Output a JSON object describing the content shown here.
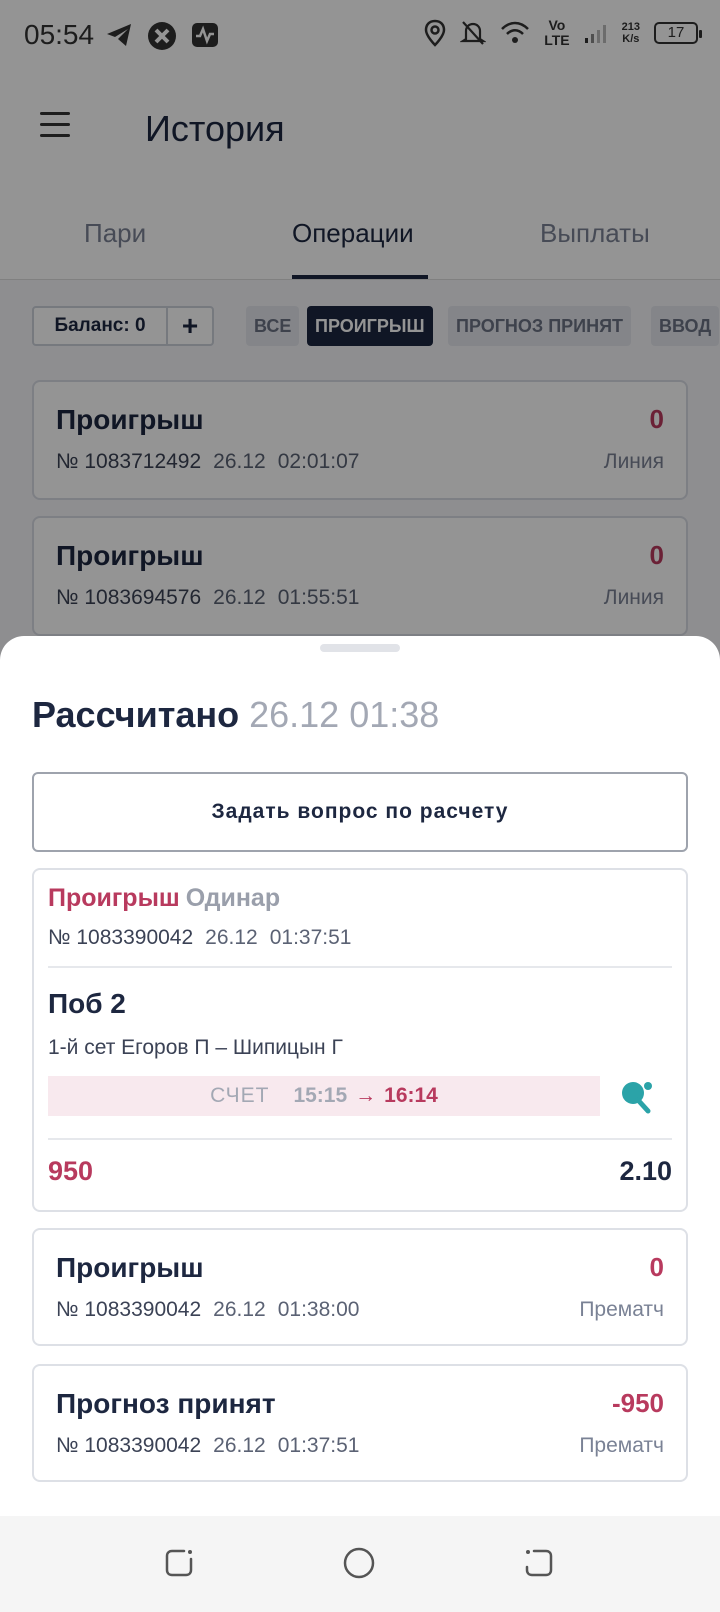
{
  "status_bar": {
    "time": "05:54",
    "network_speed_top": "213",
    "network_speed_bottom": "K/s",
    "volte_top": "Vo",
    "volte_bottom": "LTE",
    "battery": "17",
    "icons": [
      "telegram-icon",
      "app-icon",
      "activity-icon",
      "location-icon",
      "bell-off-icon",
      "wifi-icon",
      "signal-icon",
      "battery-icon"
    ]
  },
  "header": {
    "title": "История",
    "menu_icon": "hamburger-menu-icon"
  },
  "tabs": [
    {
      "label": "Пари",
      "active": false
    },
    {
      "label": "Операции",
      "active": true
    },
    {
      "label": "Выплаты",
      "active": false
    }
  ],
  "filters": {
    "balance_label": "Баланс: 0",
    "add_label": "+",
    "chips": [
      {
        "label": "ВСЕ",
        "active": false
      },
      {
        "label": "ПРОИГРЫШ",
        "active": true
      },
      {
        "label": "ПРОГНОЗ ПРИНЯТ",
        "active": false
      },
      {
        "label": "ВВОД",
        "active": false
      }
    ]
  },
  "background_operations": [
    {
      "title": "Проигрыш",
      "amount": "0",
      "number": "№ 1083712492",
      "date": "26.12",
      "time": "02:01:07",
      "type": "Линия"
    },
    {
      "title": "Проигрыш",
      "amount": "0",
      "number": "№ 1083694576",
      "date": "26.12",
      "time": "01:55:51",
      "type": "Линия"
    }
  ],
  "sheet": {
    "title": "Рассчитано",
    "datetime": "26.12 01:38",
    "ask_button": "Задать вопрос по расчету",
    "bet": {
      "status": "Проигрыш",
      "kind": "Одинар",
      "number": "№ 1083390042",
      "date": "26.12",
      "time": "01:37:51",
      "outcome": "Поб 2",
      "event": "1-й сет Егоров П – Шипицын Г",
      "score_label": "СЧЕТ",
      "score_from": "15:15",
      "score_arrow": "→",
      "score_to": "16:14",
      "sport_icon": "table-tennis-icon",
      "stake": "950",
      "coefficient": "2.10"
    },
    "operations": [
      {
        "title": "Проигрыш",
        "amount": "0",
        "number": "№ 1083390042",
        "date": "26.12",
        "time": "01:38:00",
        "type": "Прематч"
      },
      {
        "title": "Прогноз принят",
        "amount": "-950",
        "number": "№ 1083390042",
        "date": "26.12",
        "time": "01:37:51",
        "type": "Прематч"
      }
    ]
  },
  "nav_bar": {
    "icons": [
      "recents-icon",
      "home-icon",
      "back-icon"
    ]
  },
  "colors": {
    "primary_dark": "#1d2740",
    "loss_red": "#b83a5e",
    "muted_gray": "#a3a8b4",
    "score_bg": "#f8e9ee",
    "sport_icon": "#2ba3a8"
  }
}
